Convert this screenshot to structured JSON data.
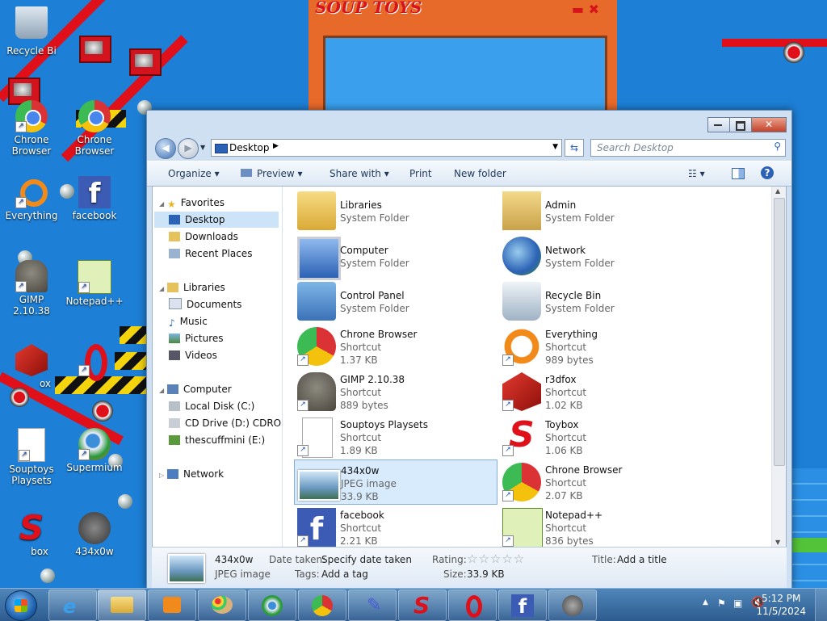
{
  "desktop": {
    "icons": [
      {
        "label": "Recycle Bi"
      },
      {
        "label": "Chrone\nBrowser"
      },
      {
        "label": "Chrone\nBrowser"
      },
      {
        "label": "Everything"
      },
      {
        "label": "facebook"
      },
      {
        "label": "GIMP 2.10.38"
      },
      {
        "label": "Notepad++"
      },
      {
        "label": "ox"
      },
      {
        "label": "Souptoys\nPlaysets"
      },
      {
        "label": "Supermium"
      },
      {
        "label": "box"
      },
      {
        "label": "434x0w"
      }
    ],
    "souptoys_logo": "SOUP TOYS"
  },
  "explorer": {
    "address": "Desktop",
    "search_placeholder": "Search Desktop",
    "toolbar": {
      "organize": "Organize",
      "preview": "Preview",
      "share_with": "Share with",
      "print": "Print",
      "new_folder": "New folder"
    },
    "nav": {
      "favorites": "Favorites",
      "desktop": "Desktop",
      "downloads": "Downloads",
      "recent_places": "Recent Places",
      "libraries": "Libraries",
      "documents": "Documents",
      "music": "Music",
      "pictures": "Pictures",
      "videos": "Videos",
      "computer": "Computer",
      "local_disk": "Local Disk (C:)",
      "cd_drive": "CD Drive (D:) CDROM",
      "usb": "thescuffmini (E:)",
      "network": "Network"
    },
    "items": [
      {
        "name": "Libraries",
        "type": "System Folder",
        "size": ""
      },
      {
        "name": "Admin",
        "type": "System Folder",
        "size": ""
      },
      {
        "name": "Computer",
        "type": "System Folder",
        "size": ""
      },
      {
        "name": "Network",
        "type": "System Folder",
        "size": ""
      },
      {
        "name": "Control Panel",
        "type": "System Folder",
        "size": ""
      },
      {
        "name": "Recycle Bin",
        "type": "System Folder",
        "size": ""
      },
      {
        "name": "Chrone Browser",
        "type": "Shortcut",
        "size": "1.37 KB"
      },
      {
        "name": "Everything",
        "type": "Shortcut",
        "size": "989 bytes"
      },
      {
        "name": "GIMP 2.10.38",
        "type": "Shortcut",
        "size": "889 bytes"
      },
      {
        "name": "r3dfox",
        "type": "Shortcut",
        "size": "1.02 KB"
      },
      {
        "name": "Souptoys Playsets",
        "type": "Shortcut",
        "size": "1.89 KB"
      },
      {
        "name": "Toybox",
        "type": "Shortcut",
        "size": "1.06 KB"
      },
      {
        "name": "434x0w",
        "type": "JPEG image",
        "size": "33.9 KB"
      },
      {
        "name": "Chrone Browser",
        "type": "Shortcut",
        "size": "2.07 KB"
      },
      {
        "name": "facebook",
        "type": "Shortcut",
        "size": "2.21 KB"
      },
      {
        "name": "Notepad++",
        "type": "Shortcut",
        "size": "836 bytes"
      }
    ],
    "details": {
      "name": "434x0w",
      "type": "JPEG image",
      "date_taken_label": "Date taken:",
      "date_taken_value": "Specify date taken",
      "tags_label": "Tags:",
      "tags_value": "Add a tag",
      "rating_label": "Rating:",
      "rating_stars": "☆☆☆☆☆",
      "size_label": "Size:",
      "size_value": "33.9 KB",
      "title_label": "Title:",
      "title_value": "Add a title"
    }
  },
  "taskbar": {
    "time": "5:12 PM",
    "date": "11/5/2024"
  },
  "colors": {
    "desktop": "#1d7fd6",
    "selection": "#d7ebfd",
    "toy_red": "#e0101a"
  }
}
